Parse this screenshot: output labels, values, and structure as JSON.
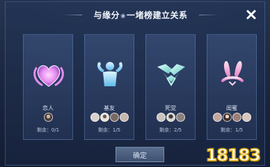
{
  "dialog": {
    "title": "与缘分",
    "title_symbol": "❀",
    "title_rest": "一堵榜建立关系",
    "confirm_label": "确定"
  },
  "relationships": [
    {
      "label": "恋人",
      "remaining": "剩余：0/1",
      "icon": "heart-icon",
      "color": "#e58cf0"
    },
    {
      "label": "基友",
      "remaining": "剩余：1/5",
      "icon": "flexing-figure-icon",
      "color": "#7fd3f5"
    },
    {
      "label": "死党",
      "remaining": "剩余：2/5",
      "icon": "handshake-icon",
      "color": "#8ee6d8"
    },
    {
      "label": "闺蜜",
      "remaining": "剩余：1/5",
      "icon": "bunny-ears-icon",
      "color": "#f08ec8"
    }
  ],
  "watermark": "18183",
  "colors": {
    "panel_border": "#6e96d2",
    "accent": "#f2f5fb"
  }
}
